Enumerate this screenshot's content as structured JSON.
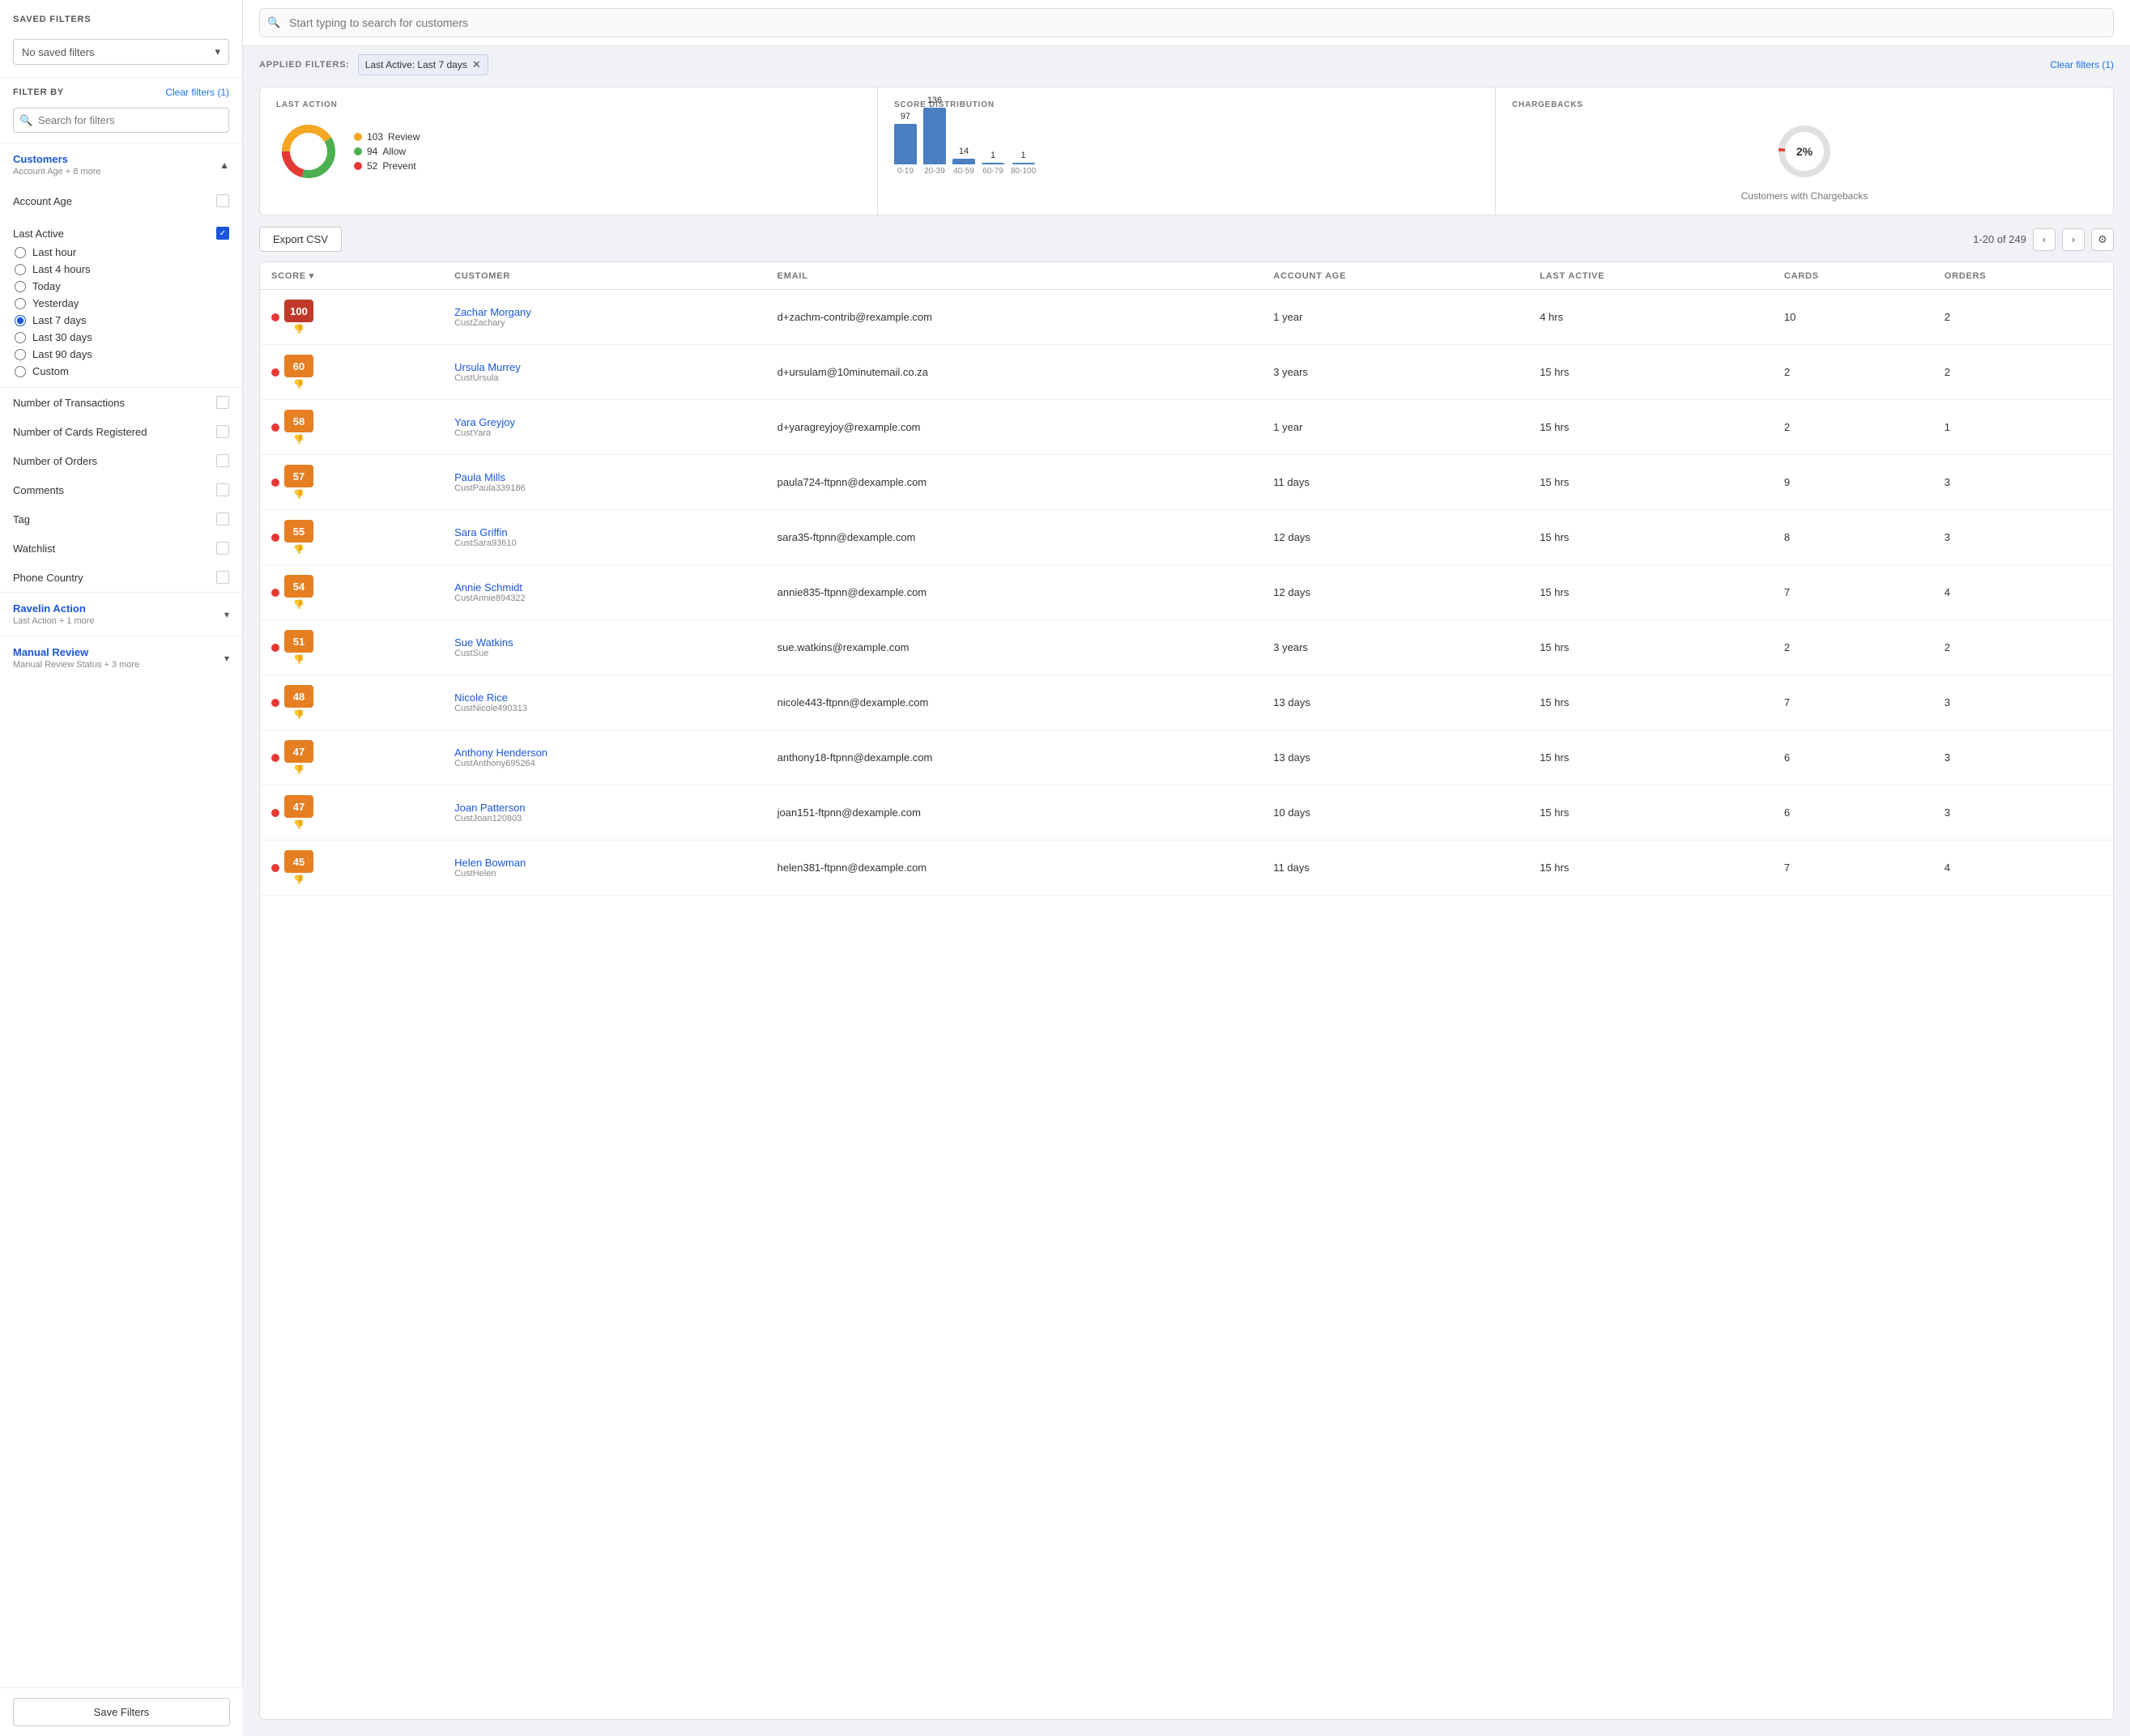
{
  "sidebar": {
    "saved_filters_label": "SAVED FILTERS",
    "saved_filters_placeholder": "No saved filters",
    "filter_by_label": "FILTER BY",
    "clear_filters_label": "Clear filters (1)",
    "search_placeholder": "Search for filters",
    "customers_section": {
      "title": "Customers",
      "subtitle": "Account Age + 8 more",
      "expanded": true,
      "items": [
        {
          "label": "Account Age",
          "checked": false
        }
      ]
    },
    "last_active": {
      "label": "Last Active",
      "checked": true,
      "options": [
        {
          "label": "Last hour",
          "value": "last_hour",
          "selected": false
        },
        {
          "label": "Last 4 hours",
          "value": "last_4_hours",
          "selected": false
        },
        {
          "label": "Today",
          "value": "today",
          "selected": false
        },
        {
          "label": "Yesterday",
          "value": "yesterday",
          "selected": false
        },
        {
          "label": "Last 7 days",
          "value": "last_7_days",
          "selected": true
        },
        {
          "label": "Last 30 days",
          "value": "last_30_days",
          "selected": false
        },
        {
          "label": "Last 90 days",
          "value": "last_90_days",
          "selected": false
        },
        {
          "label": "Custom",
          "value": "custom",
          "selected": false
        }
      ]
    },
    "filter_items": [
      {
        "label": "Number of Transactions",
        "checked": false
      },
      {
        "label": "Number of Cards Registered",
        "checked": false
      },
      {
        "label": "Number of Orders",
        "checked": false
      },
      {
        "label": "Comments",
        "checked": false
      },
      {
        "label": "Tag",
        "checked": false
      },
      {
        "label": "Watchlist",
        "checked": false
      },
      {
        "label": "Phone Country",
        "checked": false
      }
    ],
    "ravelin_action": {
      "title": "Ravelin Action",
      "subtitle": "Last Action + 1 more",
      "expanded": false
    },
    "manual_review": {
      "title": "Manual Review",
      "subtitle": "Manual Review Status + 3 more",
      "expanded": false
    },
    "save_filters_btn": "Save Filters"
  },
  "main": {
    "search_placeholder": "Start typing to search for customers",
    "applied_filters_label": "APPLIED FILTERS:",
    "clear_filters_label": "Clear filters (1)",
    "active_chip": "Last Active: Last 7 days",
    "stats": {
      "last_action": {
        "title": "LAST ACTION",
        "review": 103,
        "allow": 94,
        "prevent": 52,
        "review_label": "Review",
        "allow_label": "Allow",
        "prevent_label": "Prevent"
      },
      "score_distribution": {
        "title": "SCORE DISTRIBUTION",
        "bars": [
          {
            "label": "0-19",
            "value": 97
          },
          {
            "label": "20-39",
            "value": 136
          },
          {
            "label": "40-59",
            "value": 14
          },
          {
            "label": "60-79",
            "value": 1
          },
          {
            "label": "80-100",
            "value": 1
          }
        ]
      },
      "chargebacks": {
        "title": "CHARGEBACKS",
        "percent": "2%",
        "label": "Customers with Chargebacks"
      }
    },
    "export_btn": "Export CSV",
    "pagination": "1-20 of 249",
    "table": {
      "columns": [
        {
          "key": "score",
          "label": "SCORE",
          "sortable": true
        },
        {
          "key": "customer",
          "label": "CUSTOMER",
          "sortable": false
        },
        {
          "key": "email",
          "label": "EMAIL",
          "sortable": false
        },
        {
          "key": "account_age",
          "label": "ACCOUNT AGE",
          "sortable": false
        },
        {
          "key": "last_active",
          "label": "LAST ACTIVE",
          "sortable": false
        },
        {
          "key": "cards",
          "label": "CARDS",
          "sortable": false
        },
        {
          "key": "orders",
          "label": "ORDERS",
          "sortable": false
        }
      ],
      "rows": [
        {
          "score": 100,
          "name": "Zachar Morgany",
          "id": "CustZachary",
          "email": "d+zachm-contrib@rexample.com",
          "account_age": "1 year",
          "last_active": "4 hrs",
          "cards": 10,
          "orders": 2
        },
        {
          "score": 60,
          "name": "Ursula Murrey",
          "id": "CustUrsula",
          "email": "d+ursulam@10minutemail.co.za",
          "account_age": "3 years",
          "last_active": "15 hrs",
          "cards": 2,
          "orders": 2
        },
        {
          "score": 58,
          "name": "Yara Greyjoy",
          "id": "CustYara",
          "email": "d+yaragreyjoy@rexample.com",
          "account_age": "1 year",
          "last_active": "15 hrs",
          "cards": 2,
          "orders": 1
        },
        {
          "score": 57,
          "name": "Paula Mills",
          "id": "CustPaula339186",
          "email": "paula724-ftpnn@dexample.com",
          "account_age": "11 days",
          "last_active": "15 hrs",
          "cards": 9,
          "orders": 3
        },
        {
          "score": 55,
          "name": "Sara Griffin",
          "id": "CustSara93610",
          "email": "sara35-ftpnn@dexample.com",
          "account_age": "12 days",
          "last_active": "15 hrs",
          "cards": 8,
          "orders": 3
        },
        {
          "score": 54,
          "name": "Annie Schmidt",
          "id": "CustAnnie894322",
          "email": "annie835-ftpnn@dexample.com",
          "account_age": "12 days",
          "last_active": "15 hrs",
          "cards": 7,
          "orders": 4
        },
        {
          "score": 51,
          "name": "Sue Watkins",
          "id": "CustSue",
          "email": "sue.watkins@rexample.com",
          "account_age": "3 years",
          "last_active": "15 hrs",
          "cards": 2,
          "orders": 2
        },
        {
          "score": 48,
          "name": "Nicole Rice",
          "id": "CustNicole490313",
          "email": "nicole443-ftpnn@dexample.com",
          "account_age": "13 days",
          "last_active": "15 hrs",
          "cards": 7,
          "orders": 3
        },
        {
          "score": 47,
          "name": "Anthony Henderson",
          "id": "CustAnthony695264",
          "email": "anthony18-ftpnn@dexample.com",
          "account_age": "13 days",
          "last_active": "15 hrs",
          "cards": 6,
          "orders": 3
        },
        {
          "score": 47,
          "name": "Joan Patterson",
          "id": "CustJoan120803",
          "email": "joan151-ftpnn@dexample.com",
          "account_age": "10 days",
          "last_active": "15 hrs",
          "cards": 6,
          "orders": 3
        },
        {
          "score": 45,
          "name": "Helen Bowman",
          "id": "CustHelen",
          "email": "helen381-ftpnn@dexample.com",
          "account_age": "11 days",
          "last_active": "15 hrs",
          "cards": 7,
          "orders": 4
        }
      ]
    }
  }
}
